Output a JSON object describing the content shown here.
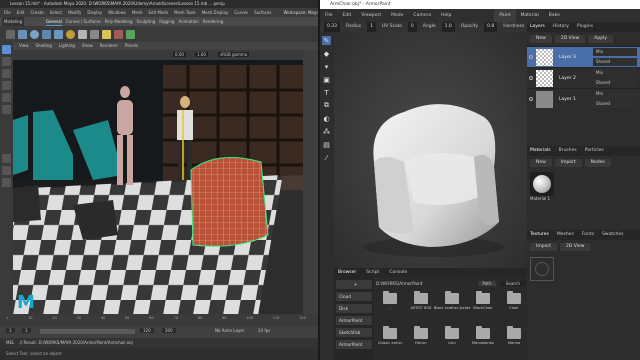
{
  "maya": {
    "title": "Lesson 15.mb* - Autodesk Maya 2020: D:\\WORKS\\MAYA 2020\\Udemy\\Arnold\\scenes\\Lesson 15.mb ... persp",
    "menu": [
      "File",
      "Edit",
      "Create",
      "Select",
      "Modify",
      "Display",
      "Windows",
      "Mesh",
      "Edit Mesh",
      "Mesh Tools",
      "Mesh Display",
      "Curves",
      "Surfaces",
      "Deform",
      "UV",
      "Generate",
      "Cache",
      "Arnold",
      "Help"
    ],
    "workspace": "Workspace: Maya Classic",
    "mode": "Modeling",
    "shelf_tabs": [
      "General",
      "Curves / Surfaces",
      "Poly Modeling",
      "Sculpting",
      "Rigging",
      "Animation",
      "Rendering"
    ],
    "active_shelf": "General",
    "view_menu": [
      "View",
      "Shading",
      "Lighting",
      "Show",
      "Renderer",
      "Panels"
    ],
    "viewport_values": {
      "a": "0.00",
      "b": "1.00",
      "colorspace": "sRGB gamma"
    },
    "time_ticks": [
      "1",
      "5",
      "10",
      "15",
      "20",
      "25",
      "30",
      "35",
      "40",
      "45",
      "50",
      "55",
      "60",
      "65",
      "70",
      "75",
      "80",
      "85",
      "90",
      "95",
      "100",
      "105",
      "110",
      "115",
      "120"
    ],
    "range": {
      "start": "1",
      "current": "1",
      "end": "120",
      "max": "200",
      "anim_layer": "No Anim Layer",
      "fps": "24 fps"
    },
    "cmd_text": "// Result: D:/WORKS/MAYA 2020/ArmorPaint/Armchair.obj",
    "help_text": "Select Tool: select an object",
    "mel": "MEL"
  },
  "armor": {
    "title": "ArmChair.obj* - ArmorPaint",
    "menu": [
      "File",
      "Edit",
      "Viewport",
      "Mode",
      "Camera",
      "Help"
    ],
    "top_tabs": [
      "Paint",
      "Material",
      "Bake"
    ],
    "header": {
      "radius_label": "Radius",
      "radius": "0.33",
      "uvscale_label": "UV Scale",
      "uvscale": "1",
      "angle_label": "Angle",
      "angle": "0",
      "opacity_label": "Opacity",
      "opacity": "1.0",
      "hardness_label": "Hardness",
      "hardness": "0.8"
    },
    "right_tabs": [
      "Layers",
      "History",
      "Plugins"
    ],
    "layer_buttons": [
      "New",
      "2D View",
      "Apply"
    ],
    "layers": [
      {
        "name": "Layer 3",
        "blend": "Mix",
        "mode": "Shared"
      },
      {
        "name": "Layer 2",
        "blend": "Mix",
        "mode": "Shared"
      },
      {
        "name": "Layer 1",
        "blend": "Mix",
        "mode": "Shared"
      }
    ],
    "mat_tabs": [
      "Materials",
      "Brushes",
      "Particles"
    ],
    "mat_buttons": [
      "New",
      "Import",
      "Nodes"
    ],
    "material_name": "Material 1",
    "tex_tabs": [
      "Textures",
      "Meshes",
      "Fonts",
      "Swatches"
    ],
    "tex_buttons": [
      "Import",
      "2D View"
    ],
    "bottom_tabs": [
      "Browser",
      "Script",
      "Console"
    ],
    "browser_path": "D:\\WORKS\\ArmorPaint",
    "browser_path_btn": "Path",
    "browser_search": "Search",
    "browser_nav": [
      "+",
      "Cloud",
      "Disk",
      "ArmorPaint",
      "SketchFab",
      "ArmorPaint"
    ],
    "folders_row1": [
      "..",
      "ARTIST BOX",
      "Black Leather Jacket",
      "BlackChair",
      "Chair"
    ],
    "folders_row2": [
      "Classic armor",
      "Falcon",
      "Lion",
      "Mandalorian",
      "Marina"
    ]
  },
  "colors": {
    "accent": "#4a6fa8",
    "maya_bg": "#444444",
    "ap_bg": "#2a2a2a",
    "viewport_floor": "#d9d9d9"
  }
}
